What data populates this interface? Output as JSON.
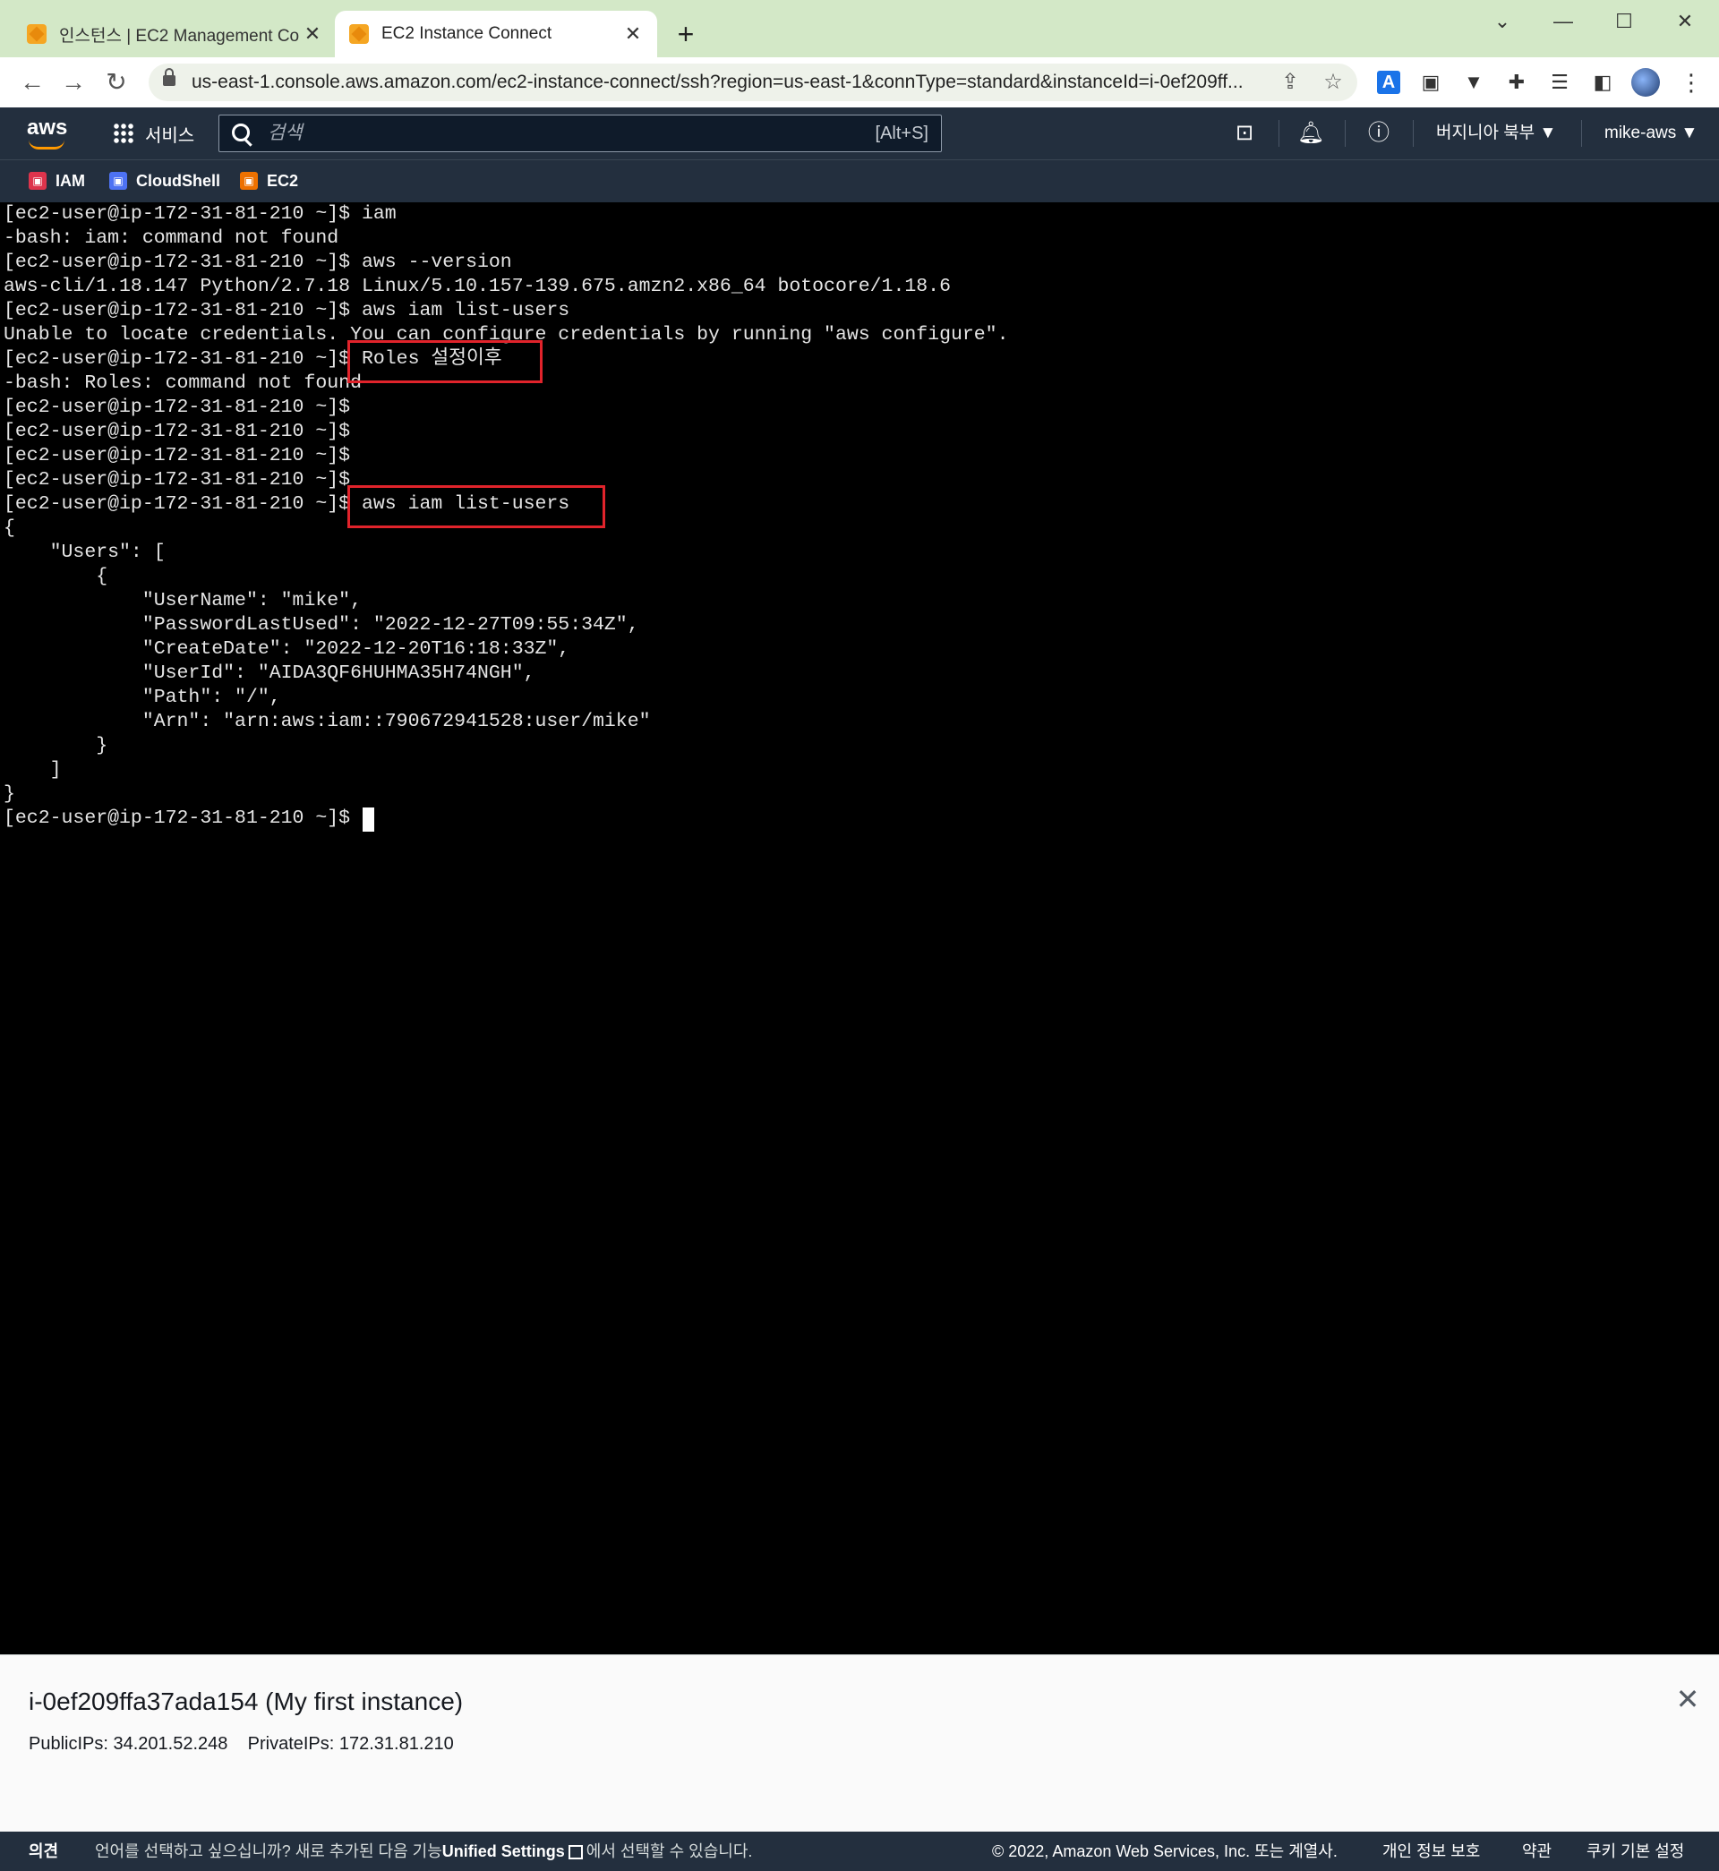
{
  "browser": {
    "tabs": [
      {
        "title": "인스턴스 | EC2 Management Co",
        "close": "✕"
      },
      {
        "title": "EC2 Instance Connect",
        "close": "✕"
      }
    ],
    "new_tab": "+",
    "window_controls": [
      "⌄",
      "—",
      "☐",
      "✕"
    ],
    "url": "us-east-1.console.aws.amazon.com/ec2-instance-connect/ssh?region=us-east-1&connType=standard&instanceId=i-0ef209ff..."
  },
  "aws_header": {
    "logo": "aws",
    "services_label": "서비스",
    "search_placeholder": "검색",
    "search_shortcut": "[Alt+S]",
    "region": "버지니아 북부 ▼",
    "account": "mike-aws ▼"
  },
  "favorites": [
    {
      "label": "IAM",
      "color": "#dd344c"
    },
    {
      "label": "CloudShell",
      "color": "#4d72f3"
    },
    {
      "label": "EC2",
      "color": "#ed7100"
    }
  ],
  "terminal": {
    "lines": [
      "[ec2-user@ip-172-31-81-210 ~]$ iam",
      "-bash: iam: command not found",
      "[ec2-user@ip-172-31-81-210 ~]$ aws --version",
      "aws-cli/1.18.147 Python/2.7.18 Linux/5.10.157-139.675.amzn2.x86_64 botocore/1.18.6",
      "[ec2-user@ip-172-31-81-210 ~]$ aws iam list-users",
      "Unable to locate credentials. You can configure credentials by running \"aws configure\".",
      "[ec2-user@ip-172-31-81-210 ~]$ Roles 설정이후",
      "-bash: Roles: command not found",
      "[ec2-user@ip-172-31-81-210 ~]$",
      "[ec2-user@ip-172-31-81-210 ~]$",
      "[ec2-user@ip-172-31-81-210 ~]$",
      "[ec2-user@ip-172-31-81-210 ~]$",
      "[ec2-user@ip-172-31-81-210 ~]$ aws iam list-users",
      "{",
      "    \"Users\": [",
      "        {",
      "            \"UserName\": \"mike\",",
      "            \"PasswordLastUsed\": \"2022-12-27T09:55:34Z\",",
      "            \"CreateDate\": \"2022-12-20T16:18:33Z\",",
      "            \"UserId\": \"AIDA3QF6HUHMA35H74NGH\",",
      "            \"Path\": \"/\",",
      "            \"Arn\": \"arn:aws:iam::790672941528:user/mike\"",
      "        }",
      "    ]",
      "}",
      "[ec2-user@ip-172-31-81-210 ~]$ "
    ]
  },
  "instance": {
    "title": "i-0ef209ffa37ada154 (My first instance)",
    "public_ips": "PublicIPs: 34.201.52.248",
    "private_ips": "PrivateIPs: 172.31.81.210"
  },
  "footer": {
    "feedback": "의견",
    "lang_prompt": "언어를 선택하고 싶으십니까? 새로 추가된 다음 기능",
    "unified_settings": "Unified Settings",
    "lang_suffix": "에서 선택할 수 있습니다.",
    "copyright": "© 2022, Amazon Web Services, Inc. 또는 계열사.",
    "privacy": "개인 정보 보호",
    "terms": "약관",
    "cookies": "쿠키 기본 설정"
  }
}
